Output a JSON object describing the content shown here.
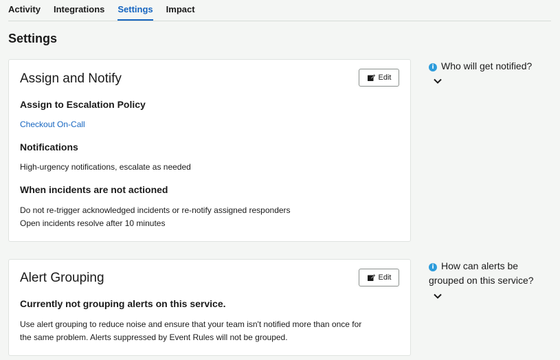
{
  "tabs": [
    {
      "label": "Activity"
    },
    {
      "label": "Integrations"
    },
    {
      "label": "Settings",
      "active": true
    },
    {
      "label": "Impact"
    }
  ],
  "page_title": "Settings",
  "assign_notify": {
    "title": "Assign and Notify",
    "edit_label": "Edit",
    "escalation_heading": "Assign to Escalation Policy",
    "escalation_link": "Checkout On-Call",
    "notifications_heading": "Notifications",
    "notifications_text": "High-urgency notifications, escalate as needed",
    "not_actioned_heading": "When incidents are not actioned",
    "not_actioned_line1": "Do not re-trigger acknowledged incidents or re-notify assigned responders",
    "not_actioned_line2": "Open incidents resolve after 10 minutes"
  },
  "alert_grouping": {
    "title": "Alert Grouping",
    "edit_label": "Edit",
    "status_heading": "Currently not grouping alerts on this service.",
    "description_line1": "Use alert grouping to reduce noise and ensure that your team isn't notified more than once for",
    "description_line2": "the same problem. Alerts suppressed by Event Rules will not be grouped."
  },
  "help": {
    "who_notified": "Who will get notified?",
    "how_grouped": "How can alerts be grouped on this service?"
  },
  "colors": {
    "accent": "#1565c0",
    "info": "#2d9cdb",
    "background": "#f4f6f4"
  }
}
